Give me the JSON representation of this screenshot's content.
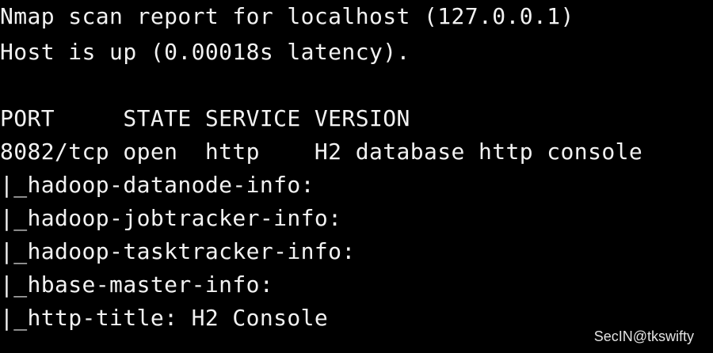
{
  "terminal": {
    "lines": [
      "Nmap scan report for localhost (127.0.0.1)",
      "Host is up (0.00018s latency).",
      "",
      "PORT     STATE SERVICE VERSION",
      "8082/tcp open  http    H2 database http console",
      "|_hadoop-datanode-info:",
      "|_hadoop-jobtracker-info:",
      "|_hadoop-tasktracker-info:",
      "|_hbase-master-info:",
      "|_http-title: H2 Console"
    ]
  },
  "watermark": {
    "text": "SecIN@tkswifty"
  }
}
